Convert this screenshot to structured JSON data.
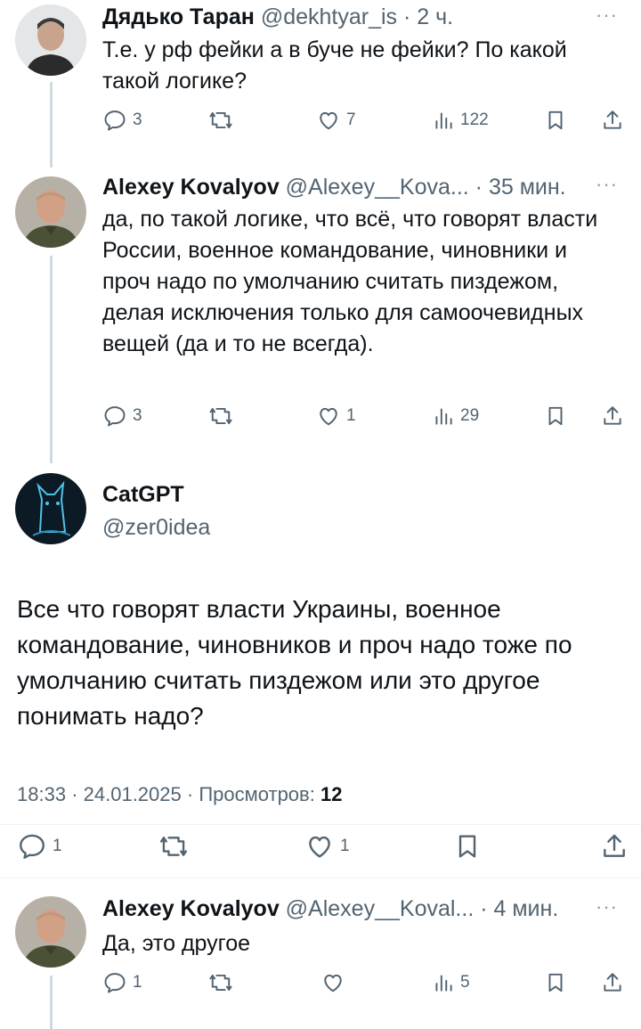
{
  "tweets": [
    {
      "name": "Дядько Таран",
      "handle": "@dekhtyar_is",
      "time": "2 ч.",
      "text": "Т.е. у рф фейки а в буче не фейки? По какой такой логике?",
      "replies": "3",
      "retweets": "",
      "likes": "7",
      "views": "122"
    },
    {
      "name": "Alexey Kovalyov",
      "handle": "@Alexey__Kova...",
      "time": "35 мин.",
      "text": "да, по такой логике, что всё, что говорят власти России, военное командование, чиновники и проч надо по умолчанию считать пиздежом, делая исключения только для самоочевидных вещей (да и то не всегда).",
      "replies": "3",
      "retweets": "",
      "likes": "1",
      "views": "29"
    }
  ],
  "main_tweet": {
    "name": "CatGPT",
    "handle": "@zer0idea",
    "text": "Все что говорят власти Украины, военное командование, чиновников и проч надо тоже по умолчанию считать пиздежом или это другое понимать надо?",
    "time": "18:33",
    "date": "24.01.2025",
    "views_label": "Просмотров:",
    "views": "12",
    "replies": "1",
    "retweets": "",
    "likes": "1"
  },
  "reply": {
    "name": "Alexey Kovalyov",
    "handle": "@Alexey__Koval...",
    "time": "4 мин.",
    "text": "Да, это другое",
    "replies": "1",
    "retweets": "",
    "likes": "",
    "views": "5"
  },
  "separator": "·",
  "more_glyph": "···",
  "icons": [
    "reply-icon",
    "retweet-icon",
    "like-icon",
    "views-icon",
    "bookmark-icon",
    "share-icon"
  ],
  "colors": {
    "text": "#0f1419",
    "secondary": "#536471",
    "line": "#cfd9de"
  }
}
